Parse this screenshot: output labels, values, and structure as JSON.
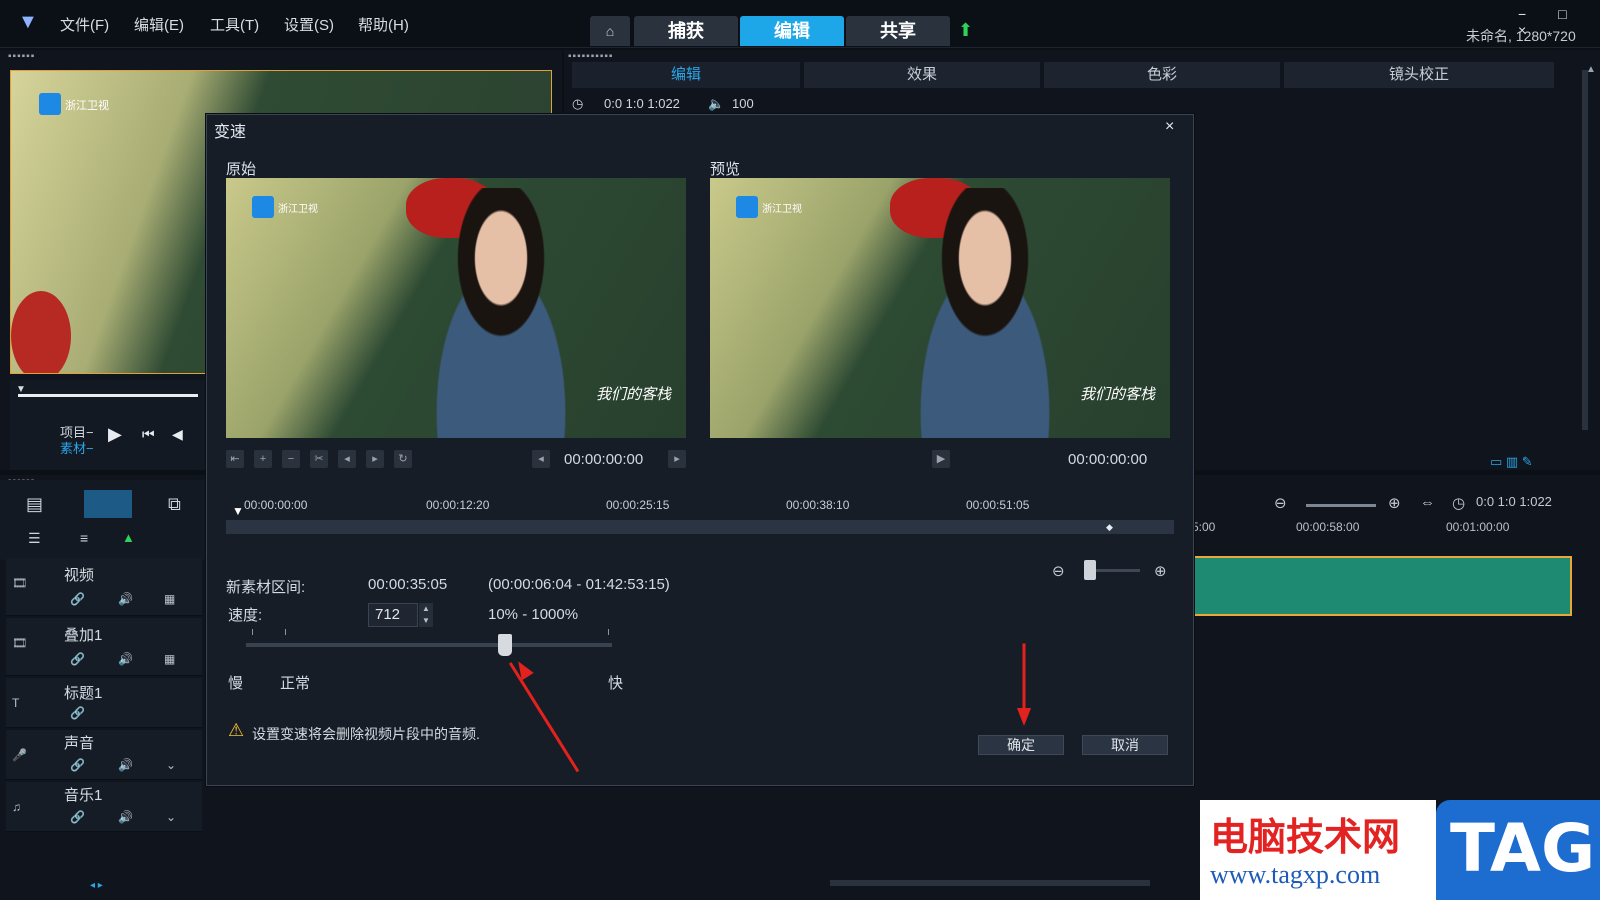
{
  "window": {
    "project_info": "未命名, 1280*720",
    "controls": "− □ ×"
  },
  "menu": [
    "文件(F)",
    "编辑(E)",
    "工具(T)",
    "设置(S)",
    "帮助(H)"
  ],
  "main_tabs": [
    "捕获",
    "编辑",
    "共享"
  ],
  "active_main_tab": "编辑",
  "right_tabs": [
    "编辑",
    "效果",
    "色彩",
    "镜头校正"
  ],
  "right_options": {
    "duration": "0:0 1:0 1:022",
    "volume": "100"
  },
  "player": {
    "project_label": "项目−",
    "clip_label": "素材−"
  },
  "tracks": [
    {
      "name": "视频"
    },
    {
      "name": "叠加1"
    },
    {
      "name": "标题1"
    },
    {
      "name": "声音"
    },
    {
      "name": "音乐1"
    }
  ],
  "timeline": {
    "ruler_ticks": [
      "5:00",
      "00:00:58:00",
      "00:01:00:00"
    ],
    "timecode": "0:0 1:0 1:022"
  },
  "dialog": {
    "title": "变速",
    "close": "×",
    "original_label": "原始",
    "preview_label": "预览",
    "original_time": "00:00:00:00",
    "preview_time": "00:00:00:00",
    "scrub_ticks": [
      "00:00:00:00",
      "00:00:12:20",
      "00:00:25:15",
      "00:00:38:10",
      "00:00:51:05"
    ],
    "new_duration_label": "新素材区间:",
    "new_duration_value": "00:00:35:05",
    "duration_range": "(00:00:06:04 - 01:42:53:15)",
    "speed_label": "速度:",
    "speed_value": "712",
    "speed_range": "10% - 1000%",
    "slow_label": "慢",
    "normal_label": "正常",
    "fast_label": "快",
    "warning_text": "设置变速将会删除视频片段中的音频.",
    "ok_label": "确定",
    "cancel_label": "取消"
  },
  "video_watermark": {
    "channel": "浙江卫视",
    "show": "我们的客栈"
  },
  "site_watermark": {
    "title": "电脑技术网",
    "url": "www.tagxp.com",
    "badge": "TAG"
  }
}
